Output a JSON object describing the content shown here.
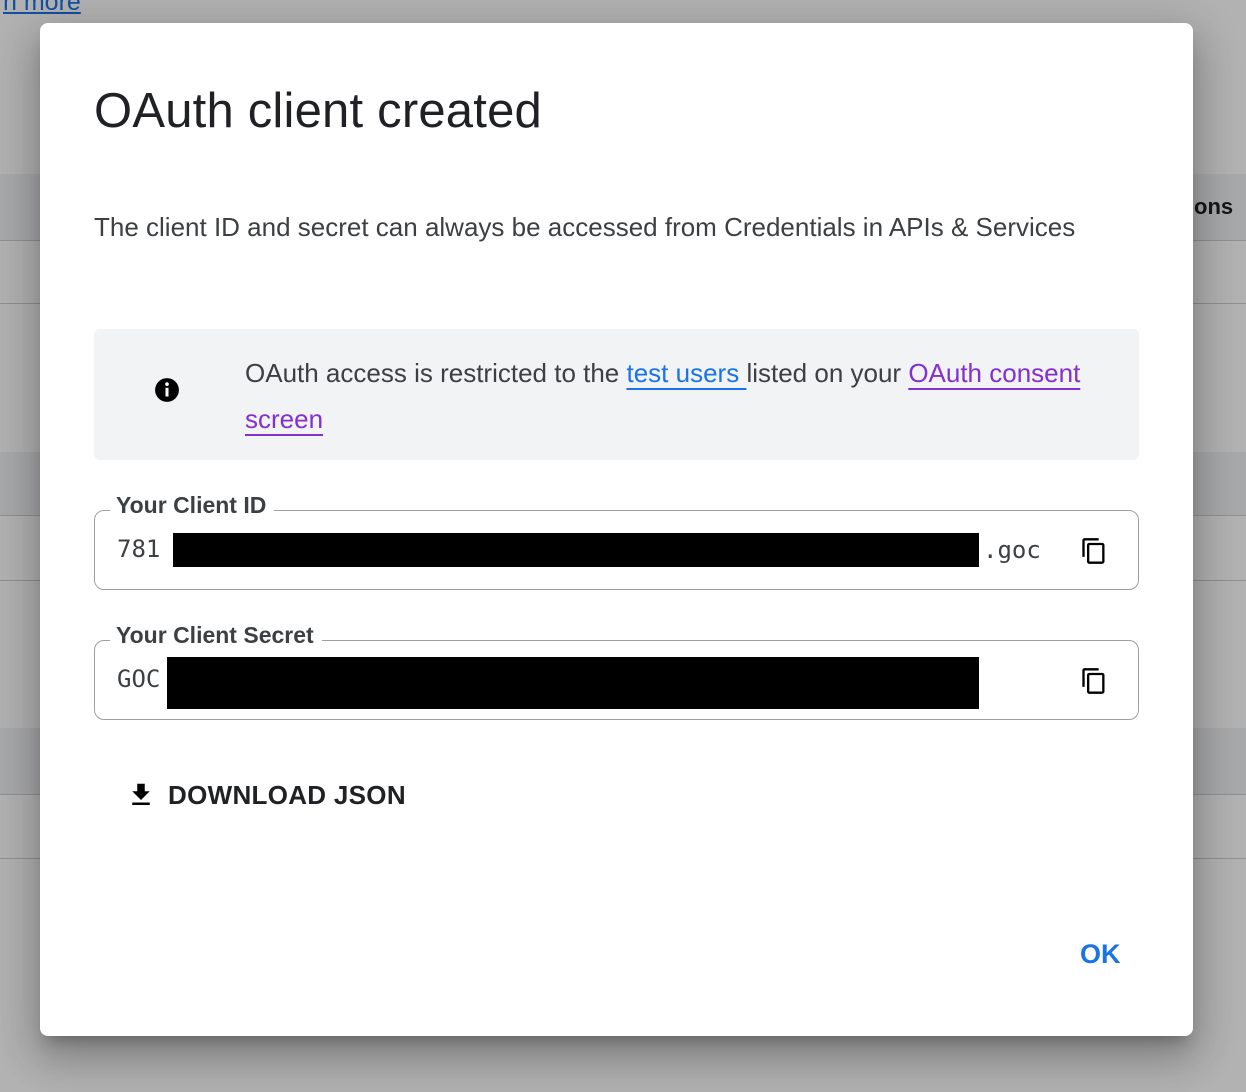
{
  "background": {
    "top_link": "n more",
    "column_header_fragment": "ons"
  },
  "dialog": {
    "title": "OAuth client created",
    "description": "The client ID and secret can always be accessed from Credentials in APIs & Services",
    "info_banner": {
      "icon": "info-icon",
      "text_before": "OAuth access is restricted to the ",
      "test_users_link": "test users ",
      "text_middle": "listed on your ",
      "consent_link": "OAuth consent screen"
    },
    "client_id": {
      "label": "Your Client ID",
      "value_prefix": "781",
      "value_suffix": ".goc",
      "copy_icon": "copy-icon"
    },
    "client_secret": {
      "label": "Your Client Secret",
      "value_prefix": "GOC",
      "copy_icon": "copy-icon"
    },
    "download_button": {
      "icon": "download-icon",
      "label": "DOWNLOAD JSON"
    },
    "ok_button": {
      "label": "OK"
    }
  },
  "colors": {
    "link_blue": "#1a73e8",
    "link_visited_purple": "#8430ce",
    "banner_bg": "#f1f3f4",
    "scrim": "rgba(0,0,0,0.30)"
  }
}
